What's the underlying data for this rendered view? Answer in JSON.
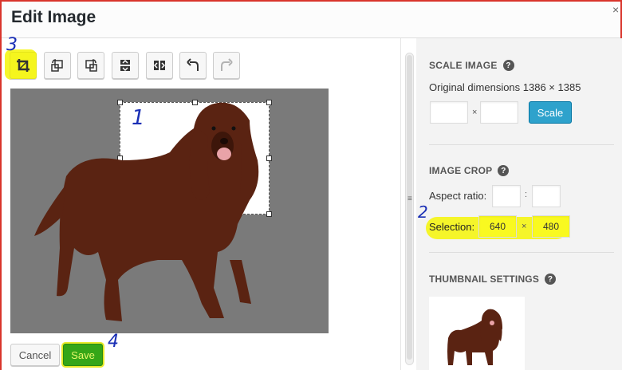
{
  "window": {
    "title": "Edit Image",
    "close_glyph": "×"
  },
  "toolbar": {
    "tools": [
      {
        "name": "crop-icon",
        "highlighted": true
      },
      {
        "name": "rotate-left-icon"
      },
      {
        "name": "rotate-right-icon"
      },
      {
        "name": "flip-vertical-icon"
      },
      {
        "name": "flip-horizontal-icon"
      },
      {
        "name": "undo-icon"
      },
      {
        "name": "redo-icon",
        "disabled": true
      }
    ]
  },
  "annotations": {
    "a1": "1",
    "a2": "2",
    "a3": "3",
    "a4": "4",
    "color": "#1a2fb5",
    "highlight": "#f5f514"
  },
  "actions": {
    "cancel_label": "Cancel",
    "save_label": "Save"
  },
  "sidebar": {
    "scale": {
      "title": "SCALE IMAGE",
      "help": "?",
      "original": "Original dimensions 1386 × 1385",
      "width": "",
      "height": "",
      "times": "×",
      "button": "Scale"
    },
    "crop": {
      "title": "IMAGE CROP",
      "help": "?",
      "aspect_label": "Aspect ratio:",
      "aspect_w": "",
      "aspect_h": "",
      "aspect_sep": ":",
      "selection_label": "Selection:",
      "selection_w": "640",
      "selection_h": "480",
      "times": "×"
    },
    "thumbnail": {
      "title": "THUMBNAIL SETTINGS",
      "help": "?"
    }
  },
  "colors": {
    "accent": "#2ea2cc",
    "save": "#35a617",
    "frame": "#d9342b",
    "canvas_bg": "#7a7a7a",
    "dog": "#5a2312"
  }
}
